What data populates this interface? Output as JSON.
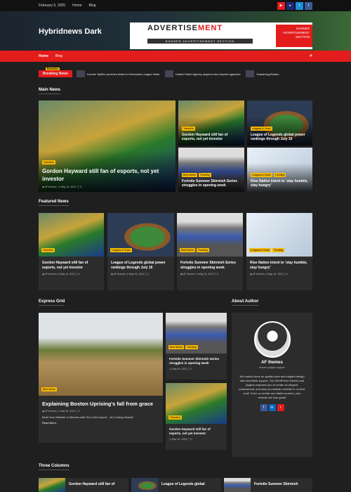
{
  "topbar": {
    "date": "February 5, 2025",
    "links": [
      "Home",
      "Blog"
    ]
  },
  "social": [
    "▶",
    "▸",
    "t",
    "f"
  ],
  "site": {
    "title": "Hybridnews Dark"
  },
  "ad": {
    "title_a": "ADVERTISE",
    "title_b": "MENT",
    "sub": "BANNER ADVERTISEMENT SECTION",
    "side": "BANNER ADVERTISEMENT SECTION"
  },
  "nav": {
    "items": [
      "Home",
      "Blog"
    ]
  },
  "ticker": {
    "label": "Breaking News",
    "badge": "Exclusive",
    "items": [
      "London Spitfire punches ticket to Overwatch League finals",
      "United Talent Agency acquires two esports agencies",
      "Explaining Boston"
    ]
  },
  "sections": {
    "main": "Main News",
    "featured": "Featured News",
    "express": "Express Grid",
    "about": "About Author",
    "three": "Three Columns"
  },
  "main_news": {
    "hero": {
      "tag": "Transfers",
      "title": "Gordon Hayward still fan of esports, not yet investor",
      "date": "May 16, 2024",
      "count": "0",
      "author": "AF themes"
    },
    "side": [
      {
        "tags": [
          "Transfers"
        ],
        "title": "Gordon Hayward still fan of esports, not yet investor"
      },
      {
        "tags": [
          "Leagues & Clubs"
        ],
        "title": "League of Legends global power rankings through July 16"
      },
      {
        "tags": [
          "Best Series",
          "Trending"
        ],
        "title": "Fortnite Summer Skirmish Series struggles in opening week"
      },
      {
        "tags": [
          "Leagues & Clubs",
          "Trending"
        ],
        "title": "Rise Nation intent to 'stay humble, stay hungry'"
      }
    ]
  },
  "featured": [
    {
      "tag": "Transfers",
      "title": "Gordon Hayward still fan of esports, not yet investor",
      "author": "AF themes",
      "date": "May 16, 2024",
      "count": "0"
    },
    {
      "tag": "Leagues & Clubs",
      "title": "League of Legends global power rankings through July 16",
      "author": "AF themes",
      "date": "May 16, 2024",
      "count": "0"
    },
    {
      "tag": "Best Series",
      "tag2": "Trending",
      "title": "Fortnite Summer Skirmish Series struggles in opening week",
      "author": "AF themes",
      "date": "May 16, 2024",
      "count": "0"
    },
    {
      "tag": "Leagues & Clubs",
      "tag2": "Trending",
      "title": "Rise Nation intent to 'stay humble, stay hungry'",
      "author": "AF themes",
      "date": "May 16, 2024",
      "count": "0"
    }
  ],
  "express": {
    "big": {
      "tag": "Best Series",
      "title": "Explaining Boston Uprising's fall from grace",
      "author": "AF themes",
      "date": "May 16, 2024",
      "count": "0",
      "excerpt": "Build Your Website in Minutes with One-Click Import – No Coding Hassle!",
      "more": "Read More..."
    },
    "small": [
      {
        "tag": "Best Series",
        "tag2": "Trending",
        "title": "Fortnite Summer Skirmish Series struggles in opening week",
        "date": "May 16, 2024",
        "count": "0"
      },
      {
        "tag": "Transfers",
        "title": "Gordon Hayward still fan of esports, not yet investor",
        "date": "May 16, 2024",
        "count": "0"
      }
    ]
  },
  "author": {
    "name": "AF themes",
    "sub": "themes.plugins.support",
    "desc": "We mainly focus on quality code and elegant design with incredible support. Our WordPress themes and plugins empower you to create an elegant, professional, and easy-to-maintain website in no time at all. Even on mobile and tablet screens, your website will look great!",
    "social": [
      "f",
      "in",
      "t"
    ]
  },
  "three": [
    {
      "title": "Gordon Hayward still fan of"
    },
    {
      "title": "League of Legends global"
    },
    {
      "title": "Fortnite Summer Skirmish"
    }
  ],
  "colors": {
    "accent": "#e31c1c",
    "tag": "#f5b800",
    "bg": "#1f1f1f",
    "card": "#2c2c2c"
  }
}
